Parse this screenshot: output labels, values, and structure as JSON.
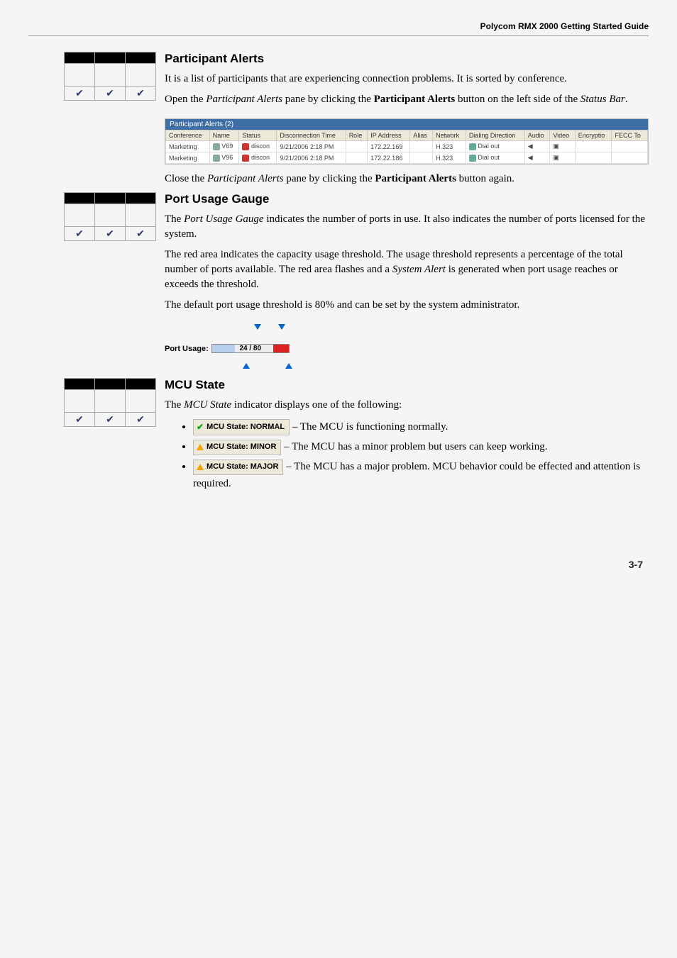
{
  "header": {
    "title": "Polycom RMX 2000 Getting Started Guide"
  },
  "sections": {
    "participant_alerts": {
      "title": "Participant Alerts",
      "para1_a": "It is a list of participants that are experiencing connection problems. It is sorted by conference.",
      "para2_a": "Open the ",
      "para2_i1": "Participant Alerts",
      "para2_b": " pane by clicking the ",
      "para2_bold": "Participant Alerts",
      "para2_c": " button on the left side of the ",
      "para2_i2": "Status Bar",
      "para2_d": ".",
      "screenshot": {
        "titlebar": "Participant Alerts (2)",
        "columns": [
          "Conference",
          "Name",
          "Status",
          "Disconnection Time",
          "Role",
          "IP Address",
          "Alias",
          "Network",
          "Dialing Direction",
          "Audio",
          "Video",
          "Encryptio",
          "FECC To"
        ],
        "rows": [
          {
            "conf": "Marketing",
            "name": "V69",
            "status": "discon",
            "time": "9/21/2006 2:18 PM",
            "role": "",
            "ip": "172.22.169",
            "alias": "",
            "net": "H.323",
            "dir": "Dial out",
            "audio": "◀",
            "video": "▣",
            "enc": "",
            "fecc": ""
          },
          {
            "conf": "Marketing",
            "name": "V96",
            "status": "discon",
            "time": "9/21/2006 2:18 PM",
            "role": "",
            "ip": "172.22.186",
            "alias": "",
            "net": "H.323",
            "dir": "Dial out",
            "audio": "◀",
            "video": "▣",
            "enc": "",
            "fecc": ""
          }
        ]
      },
      "para3_a": "Close the ",
      "para3_i1": "Participant Alerts",
      "para3_b": " pane by clicking the ",
      "para3_bold": "Participant Alerts",
      "para3_c": " button again."
    },
    "port_usage": {
      "title": "Port Usage Gauge",
      "para1_a": "The ",
      "para1_i1": "Port Usage Gauge",
      "para1_b": " indicates the number of ports in use. It also indicates the number of ports licensed for the system.",
      "para2_a": "The red area indicates the capacity usage threshold. The usage threshold represents a percentage of the total number of ports available. The red area flashes and a ",
      "para2_i1": "System Alert",
      "para2_b": " is generated when port usage reaches or exceeds the threshold.",
      "para3": "The default port usage threshold is 80% and can be set by the system administrator.",
      "gauge": {
        "label": "Port Usage:",
        "text": "24 / 80"
      }
    },
    "mcu_state": {
      "title": "MCU State",
      "intro_a": "The ",
      "intro_i": "MCU State",
      "intro_b": " indicator displays one of the following:",
      "items": [
        {
          "badge": "MCU State: NORMAL",
          "text": " – The MCU is functioning normally."
        },
        {
          "badge": "MCU State: MINOR",
          "text": " – The MCU has a minor problem but users can keep working."
        },
        {
          "badge": "MCU State: MAJOR",
          "text": " – The MCU has a major problem. MCU behavior could be effected and attention is required."
        }
      ]
    }
  },
  "page_number": "3-7",
  "checkmark": "✔"
}
